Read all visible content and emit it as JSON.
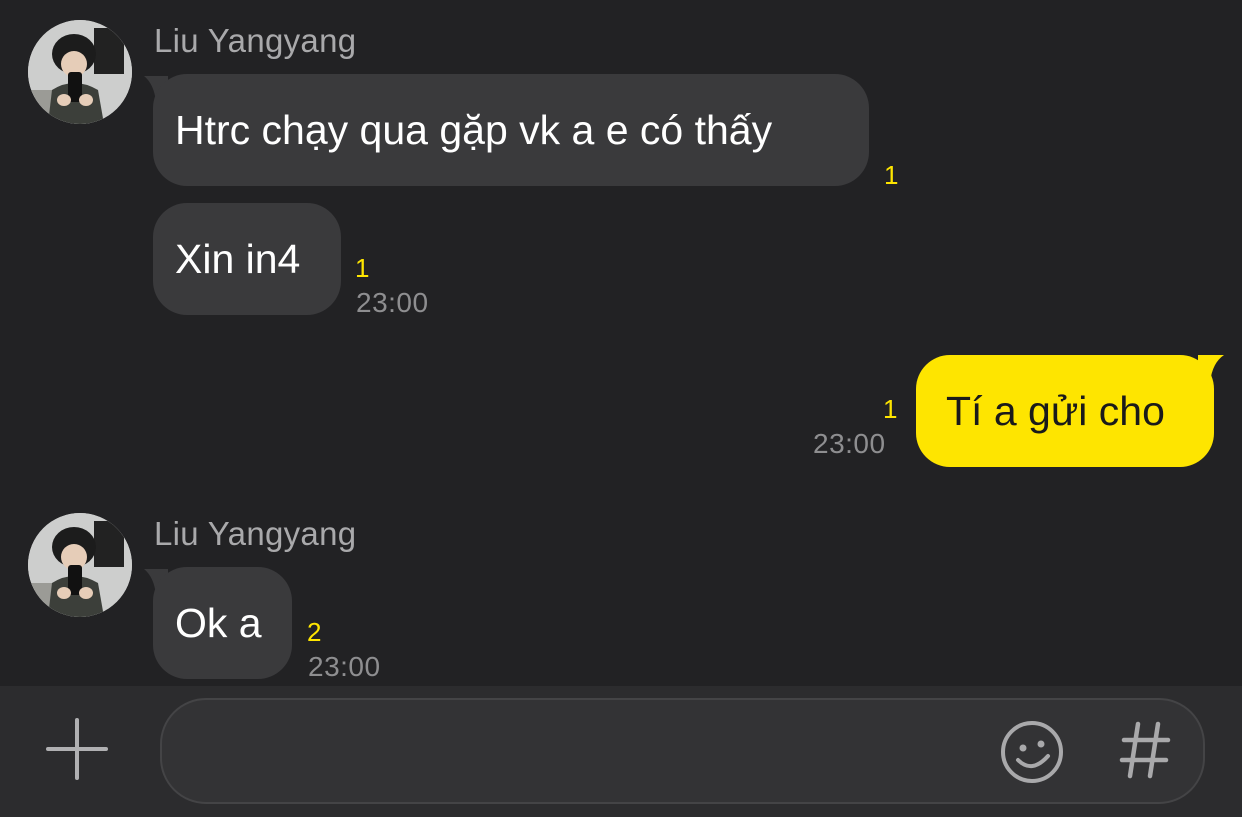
{
  "messages": [
    {
      "type": "sender",
      "name": "Liu Yangyang"
    },
    {
      "type": "incoming",
      "text": "Htrc chạy qua gặp vk a e có thấy",
      "unread": "1"
    },
    {
      "type": "incoming",
      "text": "Xin in4",
      "unread": "1",
      "time": "23:00"
    },
    {
      "type": "outgoing",
      "text": "Tí a gửi cho",
      "unread": "1",
      "time": "23:00"
    },
    {
      "type": "sender",
      "name": "Liu Yangyang"
    },
    {
      "type": "incoming",
      "text": "Ok a",
      "unread": "2",
      "time": "23:00"
    }
  ],
  "input": {
    "placeholder": ""
  },
  "icons": {
    "attach": "plus-icon",
    "emoji": "smiley-icon",
    "hashtag": "hash-icon"
  },
  "colors": {
    "background": "#222224",
    "incoming_bubble": "#3a3a3c",
    "outgoing_bubble": "#fee500",
    "unread": "#fee500"
  }
}
